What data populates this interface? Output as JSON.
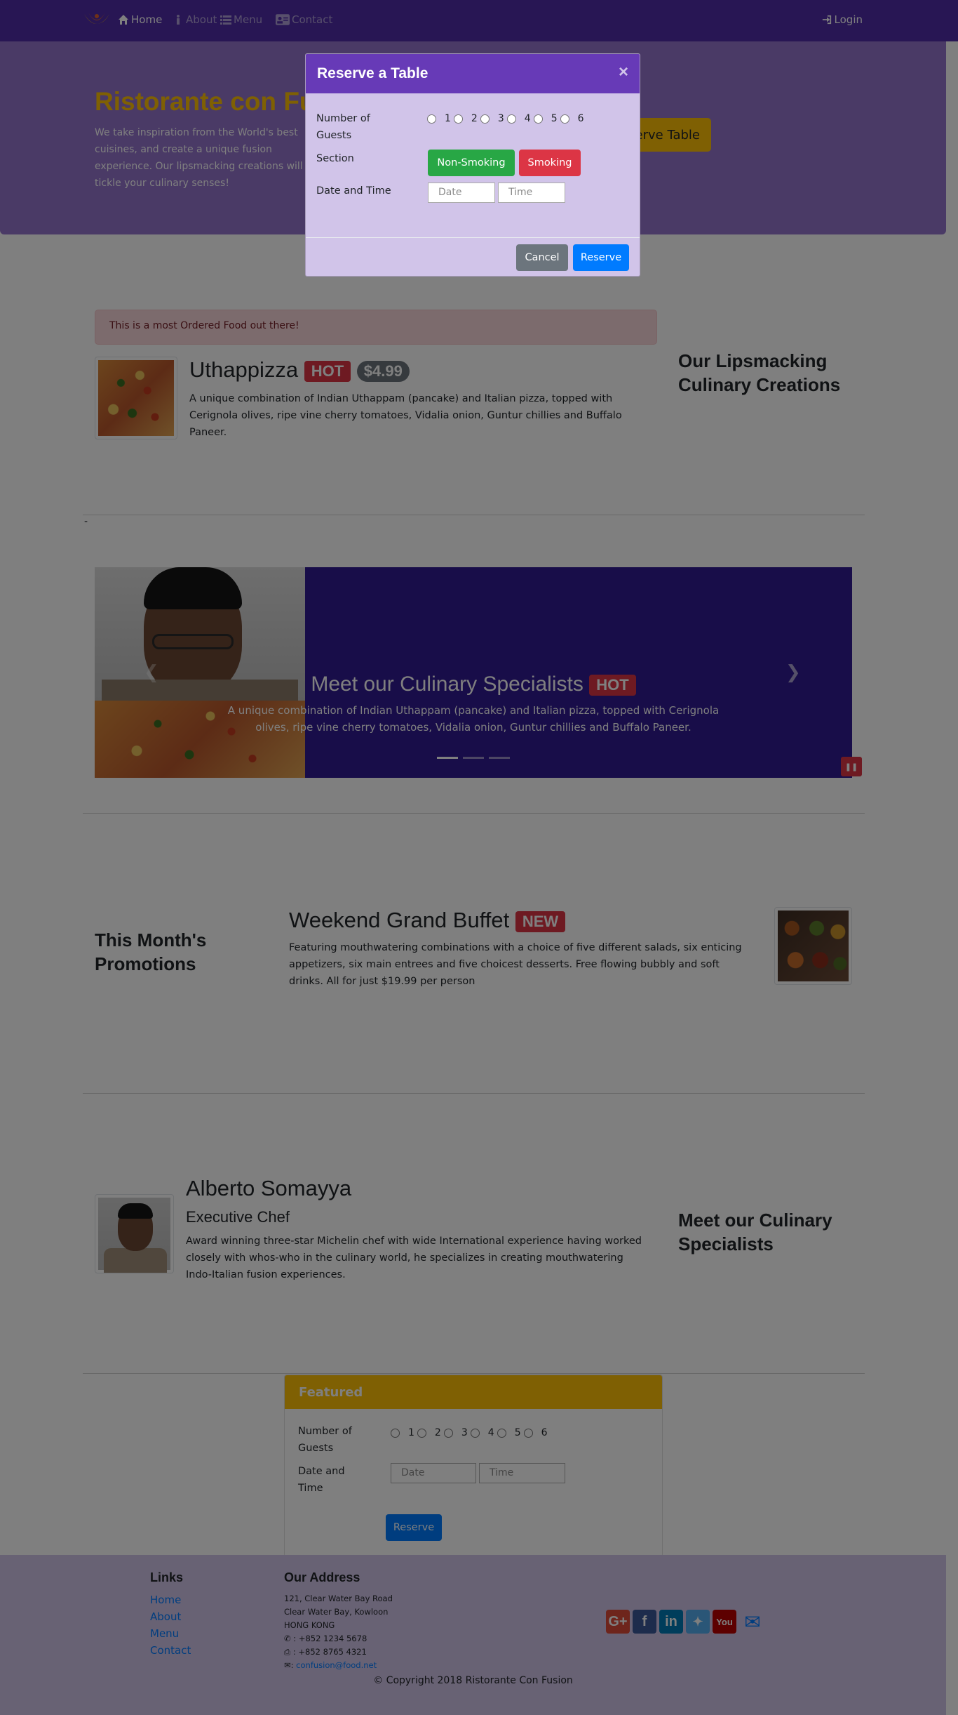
{
  "nav": {
    "items": [
      {
        "label": "Home",
        "icon": "home-icon"
      },
      {
        "label": "About",
        "icon": "info-icon"
      },
      {
        "label": "Menu",
        "icon": "list-icon"
      },
      {
        "label": "Contact",
        "icon": "address-card-icon"
      }
    ],
    "login": "Login"
  },
  "jumbotron": {
    "title": "Ristorante con Fusion",
    "text": "We take inspiration from the World's best cuisines, and create a unique fusion experience. Our lipsmacking creations will tickle your culinary senses!",
    "reserve_button": "Reserve Table"
  },
  "alert": "This is a most Ordered Food out there!",
  "dish": {
    "name": "Uthappizza",
    "badge": "HOT",
    "price": "$4.99",
    "description": "A unique combination of Indian Uthappam (pancake) and Italian pizza, topped with Cerignola olives, ripe vine cherry tomatoes, Vidalia onion, Guntur chillies and Buffalo Paneer."
  },
  "side_heading_1": "Our Lipsmacking Culinary Creations",
  "stray_text": "-",
  "carousel": {
    "title": "Meet our Culinary Specialists",
    "badge": "HOT",
    "text": "A unique combination of Indian Uthappam (pancake) and Italian pizza, topped with Cerignola olives, ripe vine cherry tomatoes, Vidalia onion, Guntur chillies and Buffalo Paneer.",
    "indicators": 3,
    "active_indicator": 0
  },
  "promotion": {
    "heading": "This Month's Promotions",
    "name": "Weekend Grand Buffet",
    "badge": "NEW",
    "description": "Featuring mouthwatering combinations with a choice of five different salads, six enticing appetizers, six main entrees and five choicest desserts. Free flowing bubbly and soft drinks. All for just $19.99 per person"
  },
  "leader": {
    "name": "Alberto Somayya",
    "designation": "Executive Chef",
    "description": "Award winning three-star Michelin chef with wide International experience having worked closely with whos-who in the culinary world, he specializes in creating mouthwatering Indo-Italian fusion experiences.",
    "side_heading": "Meet our Culinary Specialists"
  },
  "featured_form": {
    "header": "Featured",
    "guests_label": "Number of Guests",
    "guest_options": [
      "1",
      "2",
      "3",
      "4",
      "5",
      "6"
    ],
    "datetime_label": "Date and Time",
    "date_placeholder": "Date",
    "time_placeholder": "Time",
    "submit": "Reserve"
  },
  "footer": {
    "links_heading": "Links",
    "links": [
      "Home",
      "About",
      "Menu",
      "Contact"
    ],
    "address_heading": "Our Address",
    "address_lines": [
      "121, Clear Water Bay Road",
      "Clear Water Bay, Kowloon",
      "HONG KONG"
    ],
    "phone": ": +852 1234 5678",
    "fax": ": +852 8765 4321",
    "email": "confusion@food.net",
    "social": [
      "google-plus-icon",
      "facebook-icon",
      "linkedin-icon",
      "twitter-icon",
      "youtube-icon",
      "mail-icon"
    ],
    "copyright": "© Copyright 2018 Ristorante Con Fusion"
  },
  "modal": {
    "title": "Reserve a Table",
    "close": "×",
    "guests_label": "Number of Guests",
    "guest_options": [
      "1",
      "2",
      "3",
      "4",
      "5",
      "6"
    ],
    "section_label": "Section",
    "non_smoking": "Non-Smoking",
    "smoking": "Smoking",
    "datetime_label": "Date and Time",
    "date_placeholder": "Date",
    "time_placeholder": "Time",
    "cancel": "Cancel",
    "reserve": "Reserve"
  },
  "colors": {
    "primary": "#512DA8",
    "jumbotron": "#9575CD",
    "footer": "#D1C4E9",
    "warning": "#FFC107",
    "danger": "#DC3545",
    "success": "#28A745",
    "secondary": "#6C757D",
    "modal_header": "#673AB7",
    "carousel": "#311B92"
  }
}
